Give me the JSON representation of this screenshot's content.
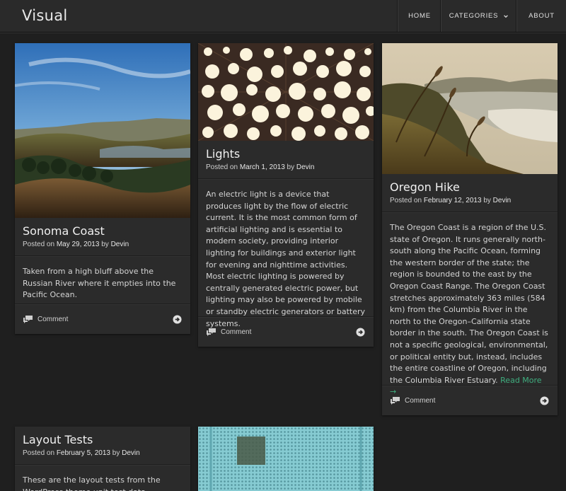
{
  "site": {
    "title": "Visual"
  },
  "nav": {
    "home": "HOME",
    "categories": "CATEGORIES",
    "about": "ABOUT"
  },
  "posts": [
    {
      "title": "Sonoma Coast",
      "posted_on": "Posted on",
      "date": "May 29, 2013",
      "by": "by",
      "author": "Devin",
      "body": "Taken from a high bluff above the Russian River where it empties into the Pacific Ocean.",
      "comment": "Comment"
    },
    {
      "title": "Lights",
      "posted_on": "Posted on",
      "date": "March 1, 2013",
      "by": "by",
      "author": "Devin",
      "body": "An electric light is a device that produces light by the flow of electric current. It is the most common form of artificial lighting and is essential to modern society, providing interior lighting for buildings and exterior light for evening and nighttime activities. Most electric lighting is powered by centrally generated electric power, but lighting may also be powered by mobile or standby electric generators or battery systems.",
      "comment": "Comment"
    },
    {
      "title": "Oregon Hike",
      "posted_on": "Posted on",
      "date": "February 12, 2013",
      "by": "by",
      "author": "Devin",
      "body": "The Oregon Coast is a region of the U.S. state of Oregon. It runs generally north-south along the Pacific Ocean, forming the western border of the state; the region is bounded to the east by the Oregon Coast Range. The Oregon Coast stretches approximately 363 miles (584 km) from the Columbia River in the north to the Oregon–California state border in the south. The Oregon Coast is not a specific geological, environmental, or political entity but, instead, includes the entire coastline of Oregon, including the Columbia River Estuary.",
      "read_more": "Read More →",
      "comment": "Comment"
    },
    {
      "title": "Layout Tests",
      "posted_on": "Posted on",
      "date": "February 5, 2013",
      "by": "by",
      "author": "Devin",
      "body": "These are the layout tests from the WordPress theme unit test data."
    }
  ]
}
